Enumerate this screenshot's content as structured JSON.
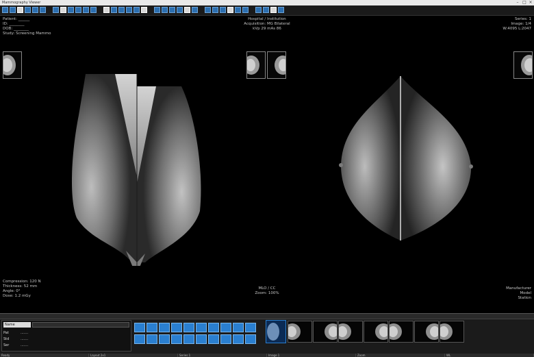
{
  "window": {
    "title": "Mammography Viewer"
  },
  "toolbar": {
    "button_count": 34
  },
  "overlays": {
    "top_left": [
      "Patient: ______",
      "ID: ________",
      "DOB: ________",
      "Study: Screening Mammo"
    ],
    "top_center": [
      "Hospital / Institution",
      "Acquisition: MG  Bilateral",
      "kVp 29  mAs 86"
    ],
    "top_right": [
      "Series: 1",
      "Image: 1/4",
      "W:4095  L:2047"
    ],
    "bottom_left": [
      "Compression: 120 N",
      "Thickness: 52 mm",
      "Angle: 0°",
      "Dose: 1.2 mGy"
    ],
    "bottom_center": [
      "MLO / CC",
      "Zoom: 100%"
    ],
    "bottom_right": [
      "Manufacturer",
      "Model",
      "Station"
    ]
  },
  "bottom_panel": {
    "field_label": "Name",
    "rows": [
      {
        "label": "Pat",
        "value": "......."
      },
      {
        "label": "Std",
        "value": "......."
      },
      {
        "label": "Ser",
        "value": "......."
      }
    ],
    "statusbar": [
      "Ready",
      "Layout 2x1",
      "Series 1",
      "Image 1",
      "Zoom",
      "WL"
    ]
  }
}
